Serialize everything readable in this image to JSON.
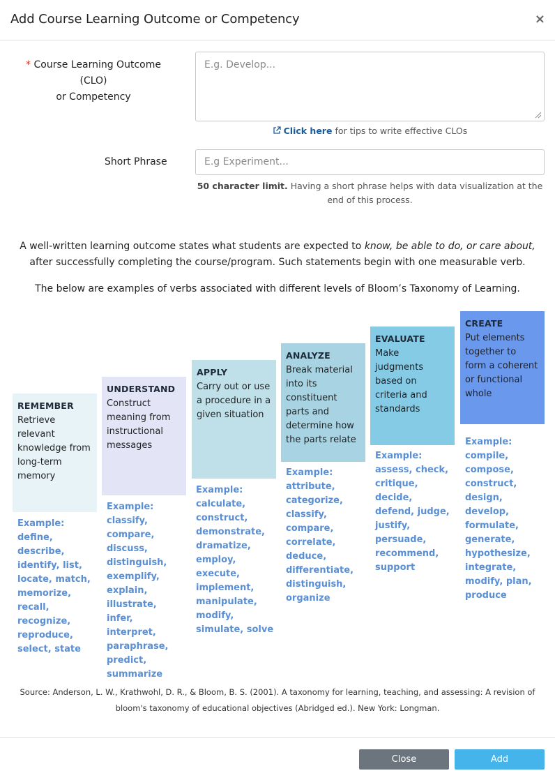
{
  "modal": {
    "title": "Add Course Learning Outcome or Competency",
    "close_glyph": "×"
  },
  "form": {
    "clo_required_mark": "*",
    "clo_label_line1": "Course Learning Outcome (CLO)",
    "clo_label_line2": "or Competency",
    "clo_placeholder": "E.g. Develop...",
    "tips_link": "Click here",
    "tips_text": "for tips to write effective CLOs",
    "short_label": "Short Phrase",
    "short_placeholder": "E.g Experiment...",
    "short_help_bold": "50 character limit.",
    "short_help_text": "Having a short phrase helps with data visualization at the end of this process."
  },
  "intro": {
    "line1_pre": "A well-written learning outcome states what students are expected to",
    "line1_em": "know, be able to do, or care about,",
    "line1_post": "after successfully completing the course/program. Such statements begin with one measurable verb.",
    "line2": "The below are examples of verbs associated with different levels of Bloom’s Taxonomy of Learning."
  },
  "levels": [
    {
      "name": "REMEMBER",
      "desc": "Retrieve relevant knowledge from long-term memory",
      "color": "#e8f3f8",
      "example": "Example: define, describe, identify, list, locate, match, memorize, recall, recognize, reproduce, select, state"
    },
    {
      "name": "UNDERSTAND",
      "desc": "Construct meaning from instructional messages",
      "color": "#e3e4f6",
      "example": "Example: classify, compare, discuss, distinguish, exemplify, explain, illustrate, infer, interpret, paraphrase, predict, summarize"
    },
    {
      "name": "APPLY",
      "desc": "Carry out or use a procedure in a given situation",
      "color": "#bfdfe9",
      "example": "Example: calculate, construct, demonstrate, dramatize, employ, execute, implement, manipulate, modify, simulate, solve"
    },
    {
      "name": "ANALYZE",
      "desc": "Break material into its constituent parts and determine how the parts relate",
      "color": "#a7d3e2",
      "example": "Example: attribute, categorize, classify, compare, correlate, deduce, differentiate, distinguish, organize"
    },
    {
      "name": "EVALUATE",
      "desc": "Make judgments based on criteria and standards",
      "color": "#86cbe6",
      "example": "Example: assess, check, critique, decide, defend, judge, justify, persuade, recommend, support"
    },
    {
      "name": "CREATE",
      "desc": "Put elements together to form a coherent or functional whole",
      "color": "#6a98ec",
      "example": "Example: compile, compose, construct, design, develop, formulate, generate, hypothesize, integrate, modify, plan, produce"
    }
  ],
  "source": "Source: Anderson, L. W., Krathwohl, D. R., & Bloom, B. S. (2001). A taxonomy for learning, teaching, and assessing: A revision of bloom's taxonomy of educational objectives (Abridged ed.). New York: Longman.",
  "buttons": {
    "close": "Close",
    "add": "Add"
  }
}
